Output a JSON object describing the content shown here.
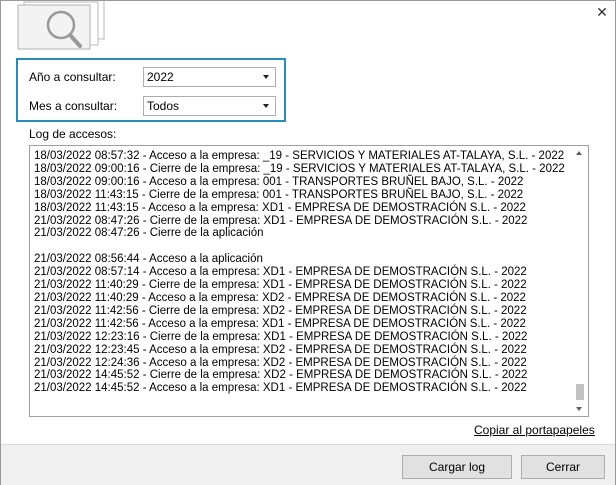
{
  "filters": {
    "year_label": "Año a consultar:",
    "year_value": "2022",
    "month_label": "Mes a consultar:",
    "month_value": "Todos"
  },
  "log": {
    "label": "Log de accesos:",
    "lines": [
      "18/03/2022 08:57:32 - Acceso a la empresa: _19 - SERVICIOS Y MATERIALES AT-TALAYA, S.L. - 2022",
      "18/03/2022 09:00:16 - Cierre de la empresa: _19 - SERVICIOS Y MATERIALES AT-TALAYA, S.L. - 2022",
      "18/03/2022 09:00:16 - Acceso a la empresa: 001 - TRANSPORTES BRUÑEL BAJO, S.L. - 2022",
      "18/03/2022 11:43:15 - Cierre de la empresa: 001 - TRANSPORTES BRUÑEL BAJO, S.L. - 2022",
      "18/03/2022 11:43:15 - Acceso a la empresa: XD1 - EMPRESA DE DEMOSTRACIÓN S.L. - 2022",
      "21/03/2022 08:47:26 - Cierre de la empresa: XD1 - EMPRESA DE DEMOSTRACIÓN S.L. - 2022",
      "21/03/2022 08:47:26 - Cierre de la aplicación",
      "",
      "21/03/2022 08:56:44 - Acceso a la aplicación",
      "21/03/2022 08:57:14 - Acceso a la empresa: XD1 - EMPRESA DE DEMOSTRACIÓN S.L. - 2022",
      "21/03/2022 11:40:29 - Cierre de la empresa: XD1 - EMPRESA DE DEMOSTRACIÓN S.L. - 2022",
      "21/03/2022 11:40:29 - Acceso a la empresa: XD2 - EMPRESA DE DEMOSTRACIÓN S.L. - 2022",
      "21/03/2022 11:42:56 - Cierre de la empresa: XD2 - EMPRESA DE DEMOSTRACIÓN S.L. - 2022",
      "21/03/2022 11:42:56 - Acceso a la empresa: XD1 - EMPRESA DE DEMOSTRACIÓN S.L. - 2022",
      "21/03/2022 12:23:16 - Cierre de la empresa: XD1 - EMPRESA DE DEMOSTRACIÓN S.L. - 2022",
      "21/03/2022 12:23:45 - Acceso a la empresa: XD2 - EMPRESA DE DEMOSTRACIÓN S.L. - 2022",
      "21/03/2022 12:24:36 - Acceso a la empresa: XD2 - EMPRESA DE DEMOSTRACIÓN S.L. - 2022",
      "21/03/2022 14:45:52 - Cierre de la empresa: XD2 - EMPRESA DE DEMOSTRACIÓN S.L. - 2022",
      "21/03/2022 14:45:52 - Acceso a la empresa: XD1 - EMPRESA DE DEMOSTRACIÓN S.L. - 2022"
    ]
  },
  "actions": {
    "copy_label": "Copiar al portapapeles",
    "load_label": "Cargar log",
    "close_label": "Cerrar"
  },
  "colors": {
    "accent_border": "#2a8ab8"
  },
  "icons": {
    "logo": "documents-magnifier-icon",
    "close": "close-icon"
  }
}
